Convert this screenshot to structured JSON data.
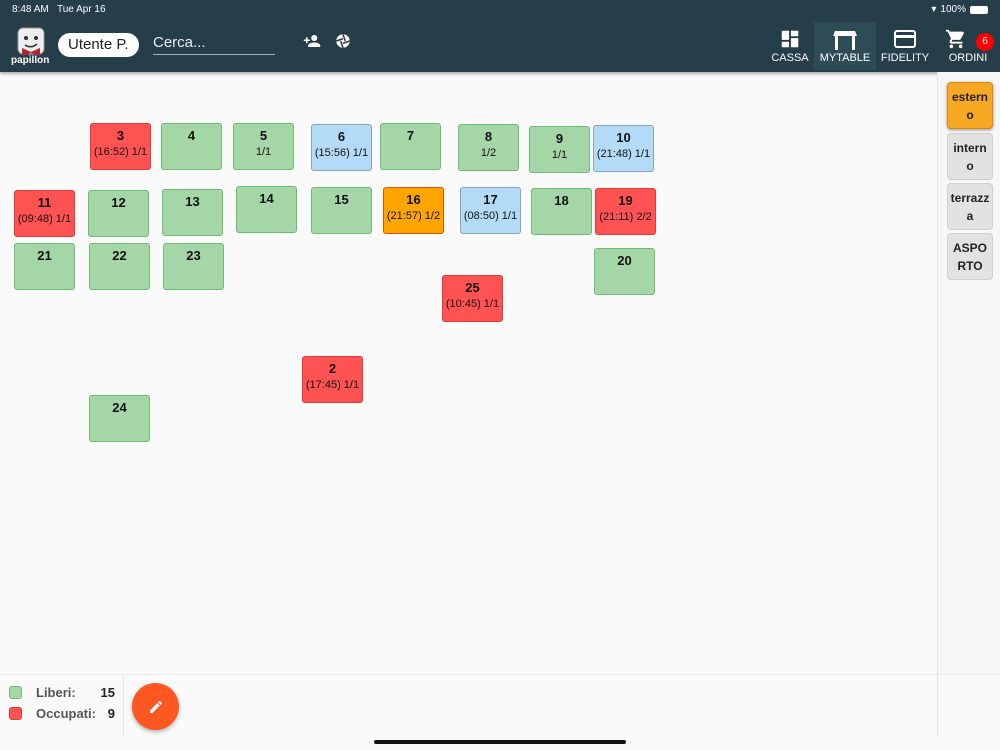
{
  "status_bar": {
    "time": "8:48 AM",
    "date": "Tue Apr 16",
    "battery": "100%"
  },
  "header": {
    "logo_text": "papillon",
    "user": "Utente P.",
    "search_placeholder": "Cerca...",
    "nav": [
      {
        "label": "CASSA"
      },
      {
        "label": "MYTABLE"
      },
      {
        "label": "FIDELITY"
      },
      {
        "label": "ORDINI",
        "badge": "6"
      }
    ]
  },
  "colors": {
    "free": "#a5d6a7",
    "busy": "#ff5252",
    "bill": "#b3dbf7",
    "partial": "#ffa500",
    "accent": "#ff5722",
    "header": "#263d4a"
  },
  "tables": [
    {
      "num": "3",
      "info": "(16:52) 1/1",
      "status": "busy"
    },
    {
      "num": "4",
      "info": "",
      "status": "free"
    },
    {
      "num": "5",
      "info": "1/1",
      "status": "free"
    },
    {
      "num": "6",
      "info": "(15:56) 1/1",
      "status": "bill"
    },
    {
      "num": "7",
      "info": "",
      "status": "free"
    },
    {
      "num": "8",
      "info": "1/2",
      "status": "free"
    },
    {
      "num": "9",
      "info": "1/1",
      "status": "free"
    },
    {
      "num": "10",
      "info": "(21:48) 1/1",
      "status": "bill"
    },
    {
      "num": "11",
      "info": "(09:48) 1/1",
      "status": "busy"
    },
    {
      "num": "12",
      "info": "",
      "status": "free"
    },
    {
      "num": "13",
      "info": "",
      "status": "free"
    },
    {
      "num": "14",
      "info": "",
      "status": "free"
    },
    {
      "num": "15",
      "info": "",
      "status": "free"
    },
    {
      "num": "16",
      "info": "(21:57) 1/2",
      "status": "partial"
    },
    {
      "num": "17",
      "info": "(08:50) 1/1",
      "status": "bill"
    },
    {
      "num": "18",
      "info": "",
      "status": "free"
    },
    {
      "num": "19",
      "info": "(21:11) 2/2",
      "status": "busy"
    },
    {
      "num": "21",
      "info": "",
      "status": "free"
    },
    {
      "num": "22",
      "info": "",
      "status": "free"
    },
    {
      "num": "23",
      "info": "",
      "status": "free"
    },
    {
      "num": "20",
      "info": "",
      "status": "free"
    },
    {
      "num": "25",
      "info": "(10:45) 1/1",
      "status": "busy"
    },
    {
      "num": "2",
      "info": "(17:45) 1/1",
      "status": "busy"
    },
    {
      "num": "24",
      "info": "",
      "status": "free"
    }
  ],
  "rooms": [
    {
      "label": "esterno",
      "active": true
    },
    {
      "label": "interno"
    },
    {
      "label": "terrazza"
    },
    {
      "label": "ASPORTO"
    }
  ],
  "legend": {
    "free_label": "Liberi:",
    "free_count": "15",
    "busy_label": "Occupati:",
    "busy_count": "9"
  }
}
